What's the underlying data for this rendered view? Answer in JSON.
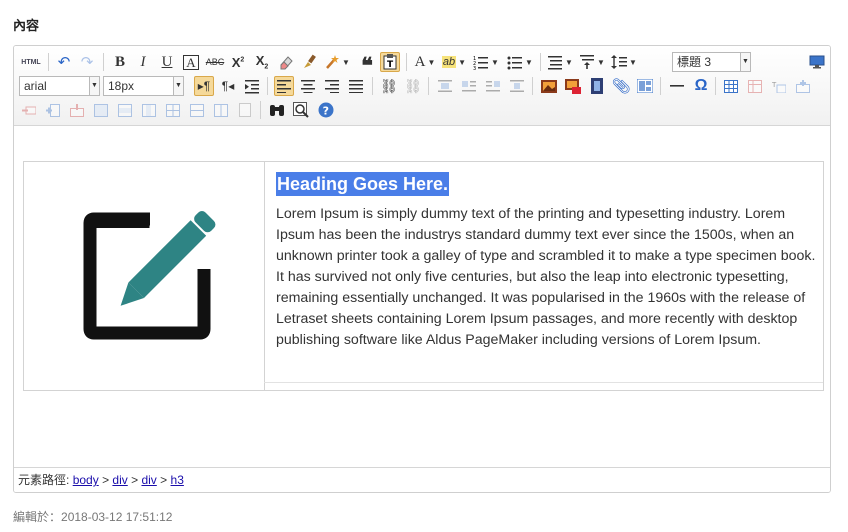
{
  "section_title": "內容",
  "toolbar": {
    "source_label": "HTML",
    "font_family": "arial",
    "font_size": "18px",
    "paragraph_format": "標題 3"
  },
  "content": {
    "heading": "Heading Goes Here.",
    "paragraph": "Lorem Ipsum is simply dummy text of the printing and typesetting industry. Lorem Ipsum has been the industrys standard dummy text ever since the 1500s, when an unknown printer took a galley of type and scrambled it to make a type specimen book. It has survived not only five centuries, but also the leap into electronic typesetting, remaining essentially unchanged. It was popularised in the 1960s with the release of Letraset sheets containing Lorem Ipsum passages, and more recently with desktop publishing software like Aldus PageMaker including versions of Lorem Ipsum."
  },
  "statusbar": {
    "label": "元素路徑:",
    "path": [
      "body",
      "div",
      "div",
      "h3"
    ],
    "separator": ">"
  },
  "footer": {
    "edited_label": "編輯於：",
    "edited_time": "2018-03-12 17:51:12"
  },
  "colors": {
    "icon_teal": "#2e8484",
    "highlight": "#4a7ee8"
  }
}
